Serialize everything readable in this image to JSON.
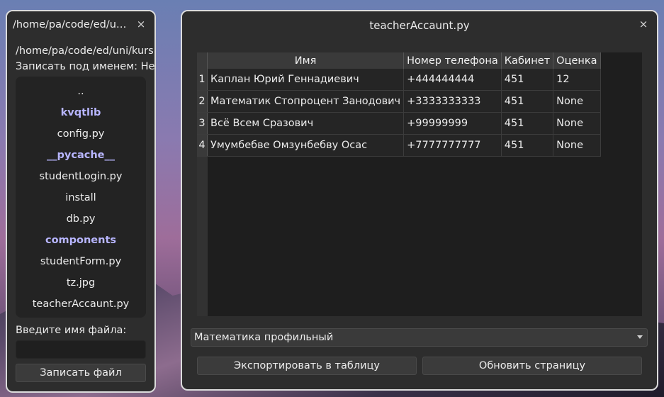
{
  "left_window": {
    "title": "/home/pa/code/ed/un...",
    "current_path": "/home/pa/code/ed/uni/kurs",
    "save_as_label": "Записать под именем:",
    "save_as_value": "Нет",
    "files": [
      {
        "name": "..",
        "is_dir": false
      },
      {
        "name": "kvqtlib",
        "is_dir": true
      },
      {
        "name": "config.py",
        "is_dir": false
      },
      {
        "name": "__pycache__",
        "is_dir": true
      },
      {
        "name": "studentLogin.py",
        "is_dir": false
      },
      {
        "name": "install",
        "is_dir": false
      },
      {
        "name": "db.py",
        "is_dir": false
      },
      {
        "name": "components",
        "is_dir": true
      },
      {
        "name": "studentForm.py",
        "is_dir": false
      },
      {
        "name": "tz.jpg",
        "is_dir": false
      },
      {
        "name": "teacherAccaunt.py",
        "is_dir": false
      }
    ],
    "filename_label": "Введите имя файла:",
    "filename_value": "",
    "write_button": "Записать файл",
    "close_icon": "×"
  },
  "right_window": {
    "title": "teacherAccaunt.py",
    "close_icon": "×",
    "table": {
      "columns": [
        "Имя",
        "Номер телефона",
        "Кабинет",
        "Оценка"
      ],
      "rows": [
        {
          "num": "1",
          "cells": [
            "Каплан Юрий Геннадиевич",
            "+444444444",
            "451",
            "12"
          ]
        },
        {
          "num": "2",
          "cells": [
            "Математик Стопроцент Занодович",
            "+3333333333",
            "451",
            "None"
          ]
        },
        {
          "num": "3",
          "cells": [
            "Всё Всем Сразович",
            "+99999999",
            "451",
            "None"
          ]
        },
        {
          "num": "4",
          "cells": [
            "Умумбебве Омзунбебву Осас",
            "+7777777777",
            "451",
            "None"
          ]
        }
      ]
    },
    "subject_select": "Математика профильный",
    "export_button": "Экспортировать в таблицу",
    "refresh_button": "Обновить страницу"
  }
}
